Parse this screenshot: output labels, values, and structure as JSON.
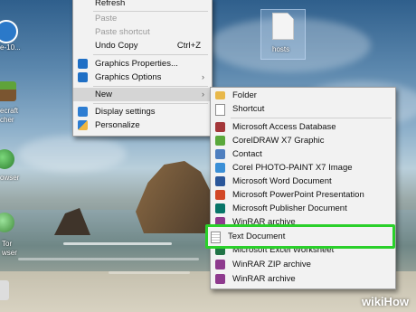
{
  "desktop": {
    "icons": [
      {
        "label": "e-10...",
        "icon": "settings-shortcut-icon",
        "color": "#2b79c9"
      },
      {
        "label": "ecraft\ncher",
        "icon": "minecraft-launcher-icon",
        "color": "#4b7a2e"
      },
      {
        "label": "owser",
        "icon": "globe-icon",
        "color": "#3d9c3f"
      },
      {
        "label": "Tor\nwser",
        "icon": "tor-browser-icon",
        "color": "#4a8c3a"
      }
    ],
    "file": {
      "label": "hosts",
      "icon": "blank-file-icon"
    }
  },
  "context_menu": {
    "items": [
      {
        "label": "Refresh",
        "shortcut": "",
        "disabled": false
      },
      {
        "label": "Paste",
        "shortcut": "",
        "disabled": true
      },
      {
        "label": "Paste shortcut",
        "shortcut": "",
        "disabled": true
      },
      {
        "label": "Undo Copy",
        "shortcut": "Ctrl+Z",
        "disabled": false
      },
      {
        "label": "Graphics Properties...",
        "icon": "intel-graphics-icon",
        "disabled": false
      },
      {
        "label": "Graphics Options",
        "icon": "intel-graphics-icon",
        "submenu": true
      },
      {
        "label": "New",
        "submenu": true,
        "highlighted": true
      },
      {
        "label": "Display settings",
        "icon": "display-settings-icon"
      },
      {
        "label": "Personalize",
        "icon": "personalize-icon"
      }
    ]
  },
  "new_submenu": {
    "items": [
      {
        "label": "Folder",
        "icon": "folder-icon",
        "color": "#e8b84a"
      },
      {
        "label": "Shortcut",
        "icon": "shortcut-icon",
        "color": "#ffffff"
      },
      {
        "label": "Microsoft Access Database",
        "icon": "access-icon",
        "color": "#a4373a"
      },
      {
        "label": "CorelDRAW X7 Graphic",
        "icon": "coreldraw-icon",
        "color": "#5aa83b"
      },
      {
        "label": "Contact",
        "icon": "contact-icon",
        "color": "#4f7fbf"
      },
      {
        "label": "Corel PHOTO-PAINT X7 Image",
        "icon": "photo-paint-icon",
        "color": "#3b8fd6"
      },
      {
        "label": "Microsoft Word Document",
        "icon": "word-icon",
        "color": "#2b579a"
      },
      {
        "label": "Microsoft PowerPoint Presentation",
        "icon": "powerpoint-icon",
        "color": "#d24726"
      },
      {
        "label": "Microsoft Publisher Document",
        "icon": "publisher-icon",
        "color": "#077568"
      },
      {
        "label": "WinRAR archive",
        "icon": "winrar-icon",
        "color": "#8e3a8e"
      },
      {
        "label": "Text Document",
        "icon": "text-document-icon",
        "color": "#ffffff",
        "emphasized": true
      },
      {
        "label": "Microsoft Excel Worksheet",
        "icon": "excel-icon",
        "color": "#217346"
      },
      {
        "label": "WinRAR ZIP archive",
        "icon": "winrar-zip-icon",
        "color": "#8e3a8e"
      },
      {
        "label": "WinRAR archive",
        "icon": "winrar-icon",
        "color": "#8e3a8e"
      }
    ],
    "emphasis_color": "#2ad02a"
  },
  "watermark": {
    "text": "wikiHow"
  }
}
